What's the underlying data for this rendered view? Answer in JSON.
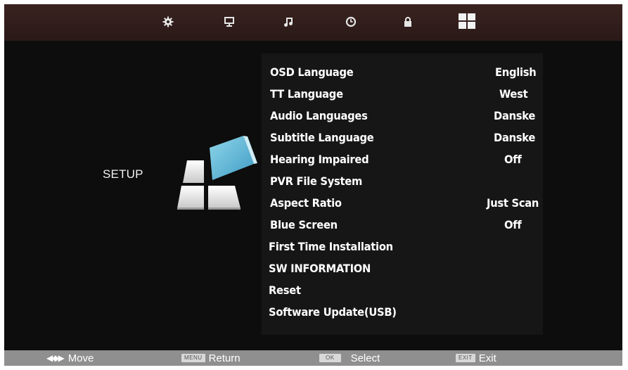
{
  "top_tabs": [
    {
      "icon": "gear-icon"
    },
    {
      "icon": "monitor-icon"
    },
    {
      "icon": "music-note-icon"
    },
    {
      "icon": "clock-icon"
    },
    {
      "icon": "lock-icon"
    },
    {
      "icon": "apps-grid-icon"
    }
  ],
  "side": {
    "title": "SETUP"
  },
  "menu": {
    "items": [
      {
        "label": "OSD Language",
        "value": "English"
      },
      {
        "label": "TT Language",
        "value": "West"
      },
      {
        "label": "Audio Languages",
        "value": "Danske"
      },
      {
        "label": "Subtitle Language",
        "value": "Danske"
      },
      {
        "label": "Hearing Impaired",
        "value": "Off"
      },
      {
        "label": "PVR File System",
        "value": ""
      },
      {
        "label": "Aspect Ratio",
        "value": "Just Scan"
      },
      {
        "label": "Blue Screen",
        "value": "Off"
      },
      {
        "label": "First Time Installation",
        "value": ""
      },
      {
        "label": "SW INFORMATION",
        "value": ""
      },
      {
        "label": "Reset",
        "value": ""
      },
      {
        "label": "Software Update(USB)",
        "value": ""
      }
    ]
  },
  "footer": {
    "move_label": "Move",
    "menu_key": "MENU",
    "return_label": "Return",
    "ok_key": "OK",
    "select_label": "Select",
    "exit_key": "EXIT",
    "exit_label": "Exit"
  },
  "colors": {
    "top_bar": "#2f1d1b",
    "background": "#0b0b0b",
    "footer": "#8f8f8f",
    "graphic_accent": "#5fb8d6"
  }
}
